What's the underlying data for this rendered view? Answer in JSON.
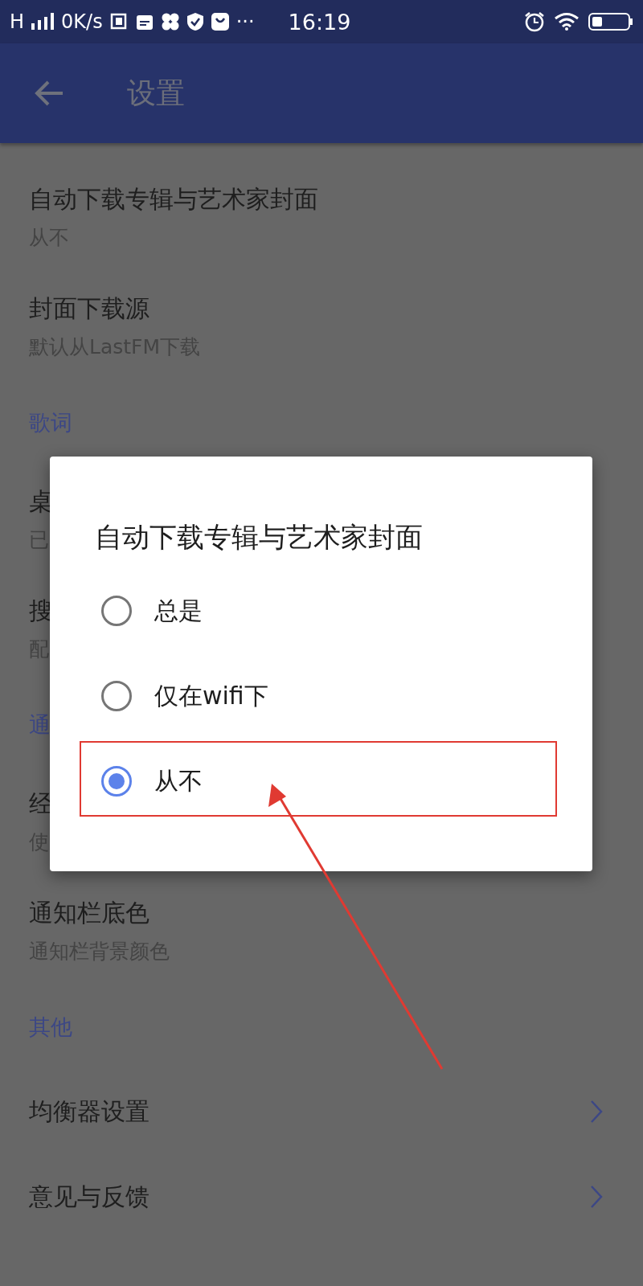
{
  "status_bar": {
    "network": "H",
    "speed": "0K/s",
    "more": "···",
    "time": "16:19"
  },
  "toolbar": {
    "title": "设置"
  },
  "settings": [
    {
      "kind": "item",
      "title": "自动下载专辑与艺术家封面",
      "subtitle": "从不"
    },
    {
      "kind": "item",
      "title": "封面下载源",
      "subtitle": "默认从LastFM下载"
    },
    {
      "kind": "header",
      "title": "歌词"
    },
    {
      "kind": "item",
      "title": "桌",
      "subtitle": "已"
    },
    {
      "kind": "item",
      "title": "搜",
      "subtitle": "配"
    },
    {
      "kind": "header",
      "title": "通"
    },
    {
      "kind": "item",
      "title": "经",
      "subtitle": "使"
    },
    {
      "kind": "item",
      "title": "通知栏底色",
      "subtitle": "通知栏背景颜色"
    },
    {
      "kind": "header",
      "title": "其他"
    },
    {
      "kind": "link",
      "title": "均衡器设置"
    },
    {
      "kind": "link",
      "title": "意见与反馈"
    }
  ],
  "dialog": {
    "title": "自动下载专辑与艺术家封面",
    "options": [
      {
        "label": "总是",
        "selected": false
      },
      {
        "label": "仅在wifi下",
        "selected": false
      },
      {
        "label": "从不",
        "selected": true
      }
    ]
  }
}
